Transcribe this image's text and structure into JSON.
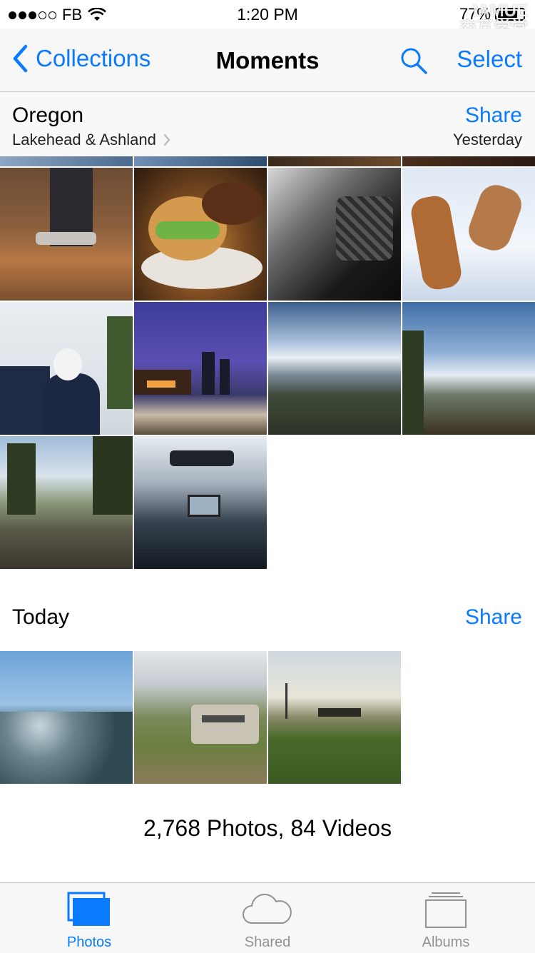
{
  "status_bar": {
    "carrier": "FB",
    "time": "1:20 PM",
    "battery": "77%",
    "watermark_line1": "IAMUE",
    "watermark_line2": "交互学堂"
  },
  "nav": {
    "back_label": "Collections",
    "title": "Moments",
    "select_label": "Select"
  },
  "moments": [
    {
      "title": "Oregon",
      "subtitle": "Lakehead & Ashland",
      "share_label": "Share",
      "date": "Yesterday",
      "photo_count": 10
    },
    {
      "title": "Today",
      "share_label": "Share",
      "photo_count": 3
    }
  ],
  "summary": "2,768 Photos, 84 Videos",
  "tabs": [
    {
      "label": "Photos",
      "icon": "photos-icon",
      "active": true
    },
    {
      "label": "Shared",
      "icon": "cloud-icon",
      "active": false
    },
    {
      "label": "Albums",
      "icon": "albums-icon",
      "active": false
    }
  ],
  "colors": {
    "accent": "#0a7aff",
    "inactive_tab": "#929292"
  }
}
